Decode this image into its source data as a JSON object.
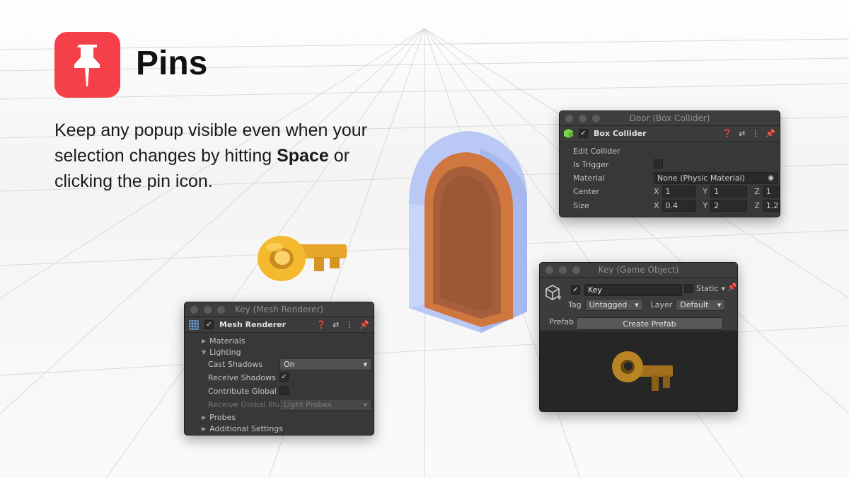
{
  "app": {
    "title": "Pins",
    "tagline_part1": "Keep any popup visible even when your selection changes by hitting ",
    "tagline_bold": "Space",
    "tagline_part2": " or clicking the pin icon."
  },
  "colors": {
    "accent": "#f5404a",
    "window_bg": "#383838",
    "door_frame": "#b8c8f4",
    "door_wood": "#b5683f",
    "key_gold": "#f2b52e"
  },
  "door_window": {
    "title": "Door (Box Collider)",
    "component": "Box Collider",
    "edit_collider": "Edit Collider",
    "is_trigger_label": "Is Trigger",
    "material_label": "Material",
    "material_value": "None (Physic Material)",
    "center_label": "Center",
    "size_label": "Size",
    "axis_x": "X",
    "axis_y": "Y",
    "axis_z": "Z",
    "center": {
      "x": "1",
      "y": "1",
      "z": "1"
    },
    "size": {
      "x": "0.4",
      "y": "2",
      "z": "1.2"
    }
  },
  "mesh_window": {
    "title": "Key (Mesh Renderer)",
    "component": "Mesh Renderer",
    "materials": "Materials",
    "lighting": "Lighting",
    "cast_shadows_label": "Cast Shadows",
    "cast_shadows_value": "On",
    "receive_shadows_label": "Receive Shadows",
    "contribute_gi_label": "Contribute Global Il",
    "receive_gi_label": "Receive Global Illum",
    "receive_gi_value": "Light Probes",
    "probes": "Probes",
    "additional_settings": "Additional Settings"
  },
  "go_window": {
    "title": "Key (Game Object)",
    "name": "Key",
    "static_label": "Static",
    "tag_label": "Tag",
    "tag_value": "Untagged",
    "layer_label": "Layer",
    "layer_value": "Default",
    "prefab_label": "Prefab",
    "create_prefab": "Create Prefab"
  },
  "icons": [
    "pushpin-icon",
    "question-icon",
    "sliders-icon",
    "kebab-icon",
    "pin-icon",
    "cube-icon",
    "mesh-renderer-icon",
    "target-icon",
    "checkmark-icon",
    "triangle-icon"
  ]
}
